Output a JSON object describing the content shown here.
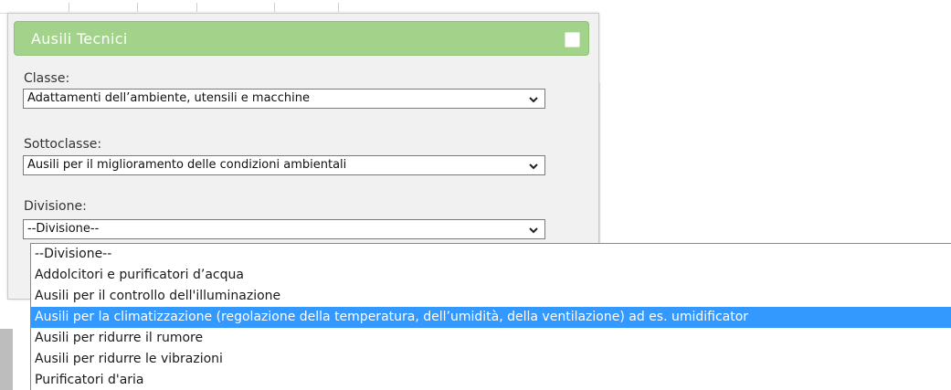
{
  "panel": {
    "title": "Ausili Tecnici",
    "header_color": "#a3d38a"
  },
  "fields": {
    "classe": {
      "label": "Classe:",
      "value": "Adattamenti dell’ambiente, utensili e macchine"
    },
    "sottoclasse": {
      "label": "Sottoclasse:",
      "value": "Ausili per il miglioramento delle condizioni ambientali"
    },
    "divisione": {
      "label": "Divisione:",
      "value": "--Divisione--"
    }
  },
  "dropdown": {
    "options": [
      "--Divisione--",
      "Addolcitori e purificatori d’acqua",
      "Ausili per il controllo dell'illuminazione",
      "Ausili per la climatizzazione (regolazione della temperatura, dell’umidità, della ventilazione) ad es. umidificator",
      "Ausili per ridurre il rumore",
      "Ausili per ridurre le vibrazioni",
      "Purificatori d'aria"
    ],
    "highlighted_index": 3,
    "highlight_color": "#3399ff"
  }
}
